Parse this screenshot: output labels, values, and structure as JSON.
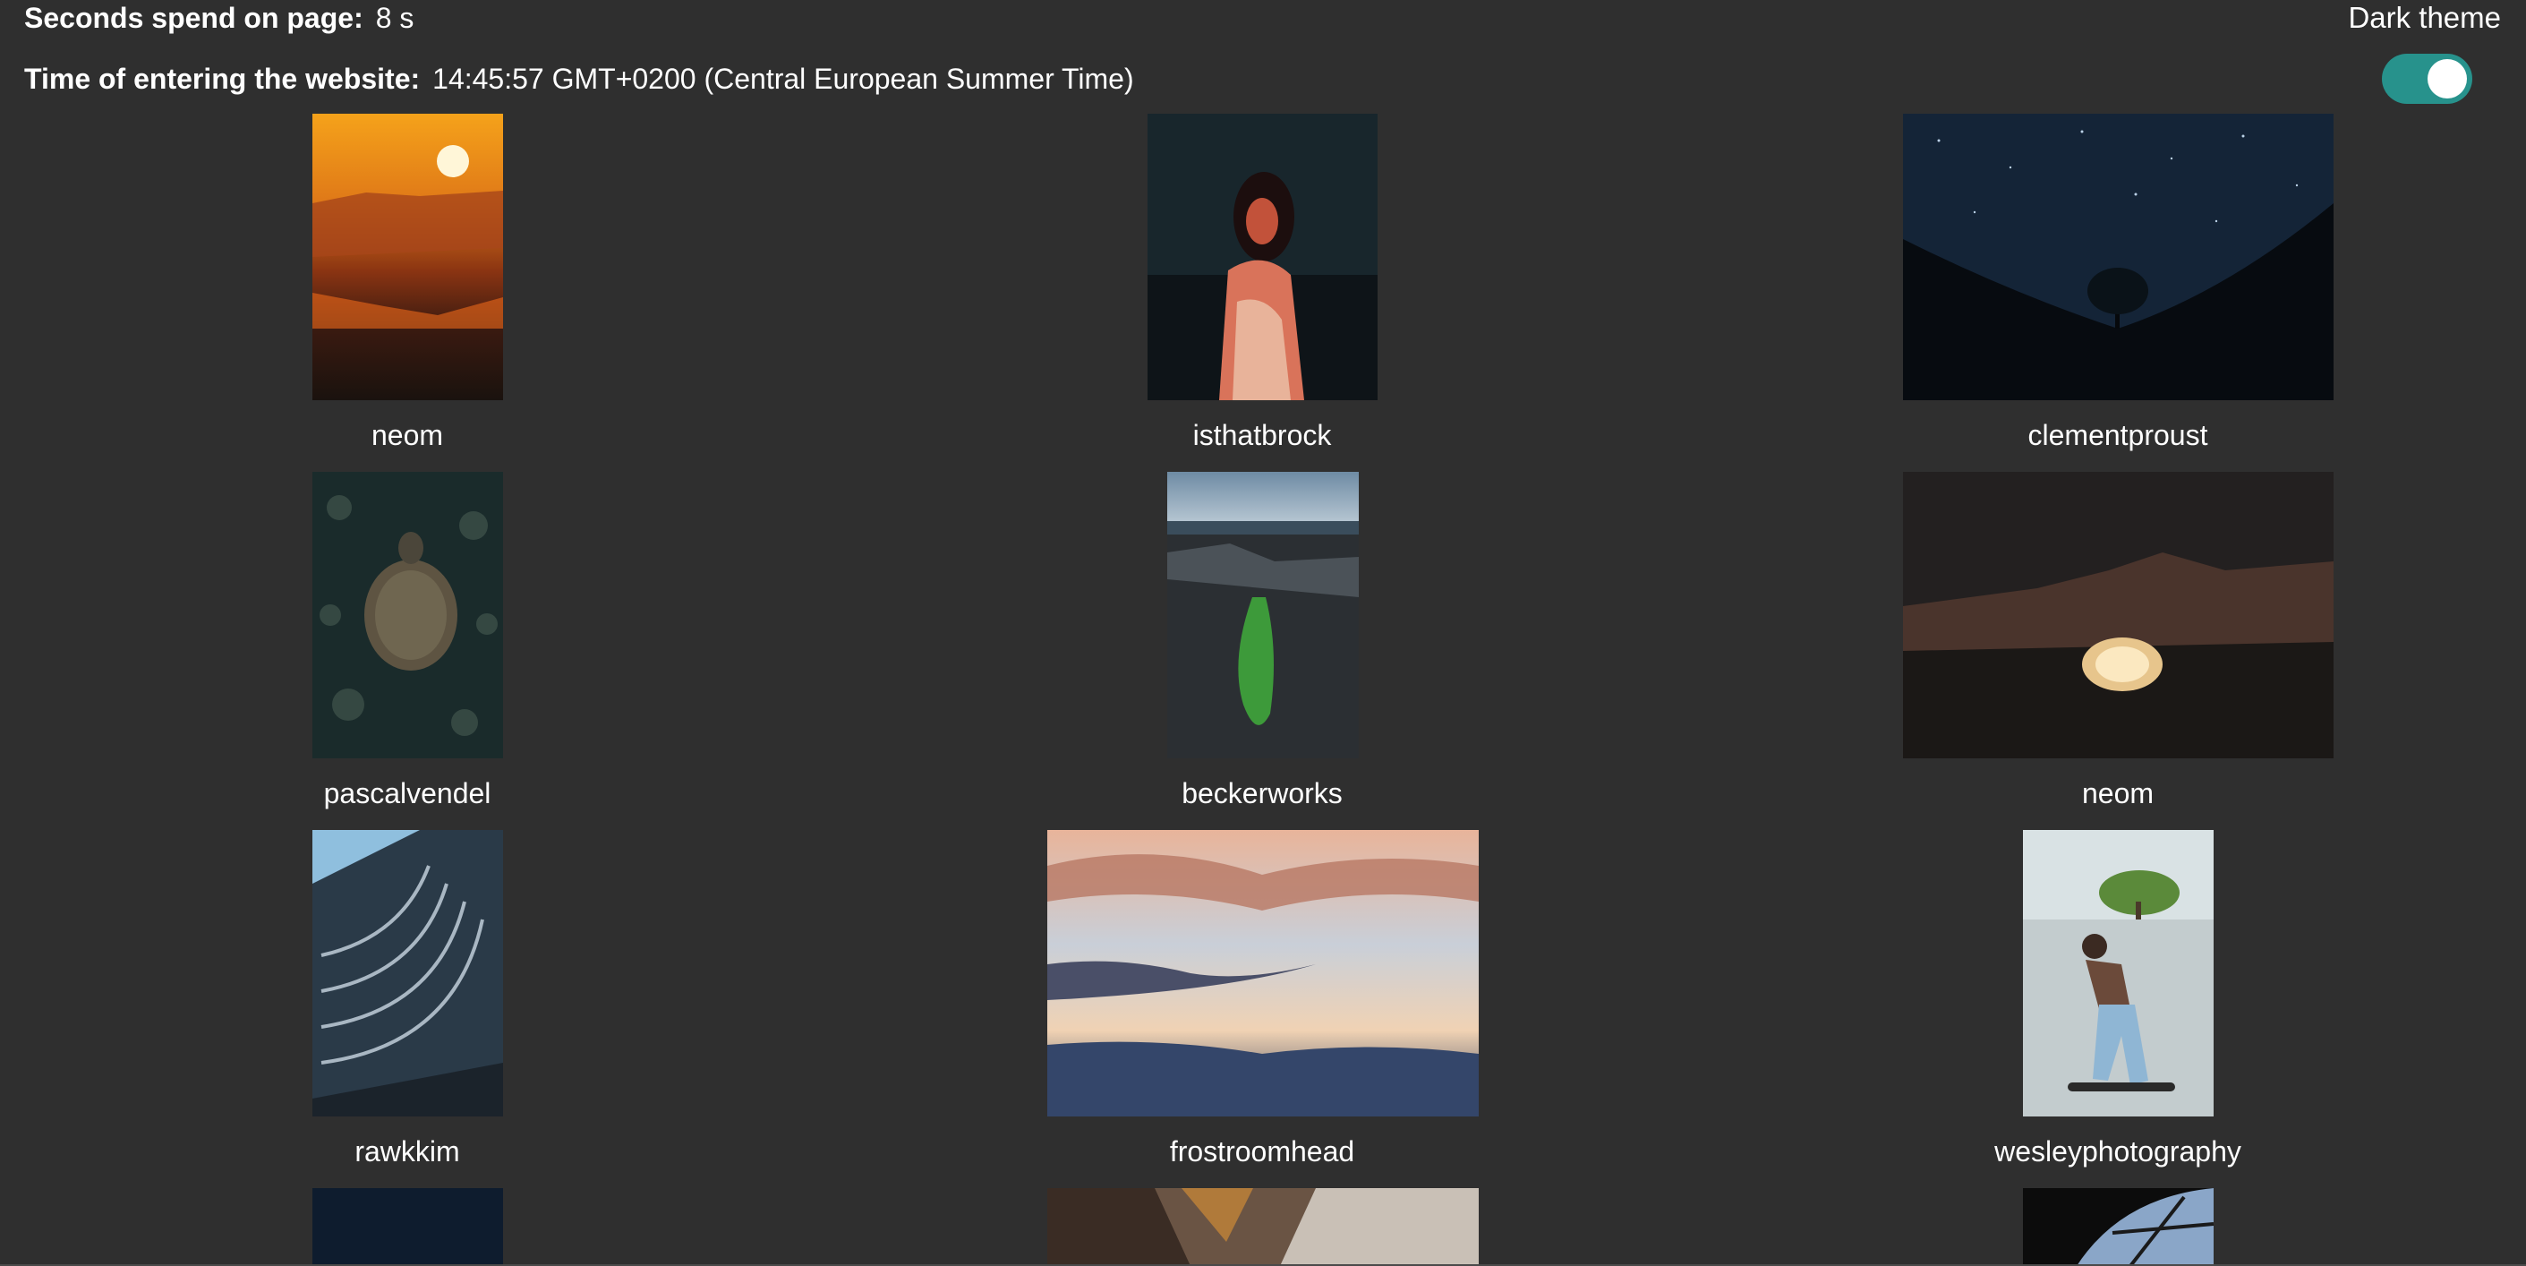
{
  "header": {
    "seconds_label": "Seconds spend on page:",
    "seconds_value": "8 s",
    "time_label": "Time of entering the website:",
    "time_value": "14:45:57 GMT+0200 (Central European Summer Time)",
    "theme_label": "Dark theme",
    "theme_toggle_on": true,
    "accent_color": "#27928c",
    "background_color": "#2f2f2f"
  },
  "gallery": [
    {
      "author": "neom",
      "image": "sunset-over-canyon-photo"
    },
    {
      "author": "isthatbrock",
      "image": "woman-in-red-light-photo"
    },
    {
      "author": "clementproust",
      "image": "tree-under-starry-sky-photo"
    },
    {
      "author": "pascalvendel",
      "image": "sea-turtle-on-reef-photo"
    },
    {
      "author": "beckerworks",
      "image": "green-rock-pool-photo"
    },
    {
      "author": "neom",
      "image": "glowing-tent-in-desert-photo"
    },
    {
      "author": "rawkkim",
      "image": "curved-glass-building-photo"
    },
    {
      "author": "frostroomhead",
      "image": "sunset-clouds-photo"
    },
    {
      "author": "wesleyphotography",
      "image": "skateboarder-photo"
    },
    {
      "author": "",
      "image": "dark-blue-sky-photo"
    },
    {
      "author": "",
      "image": "rocky-canyon-photo"
    },
    {
      "author": "",
      "image": "glass-dome-photo"
    }
  ]
}
